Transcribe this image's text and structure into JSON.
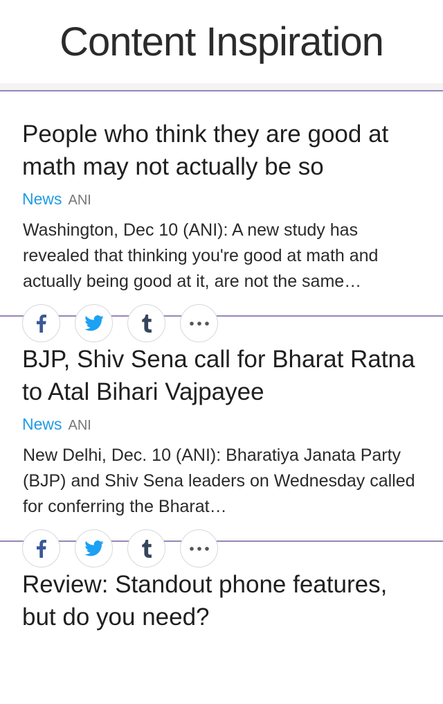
{
  "header": {
    "title": "Content Inspiration"
  },
  "colors": {
    "accent": "#1e9be6",
    "divider": "#9686b8",
    "facebook": "#3b5998",
    "twitter": "#1da1f2",
    "tumblr": "#35465c"
  },
  "articles": [
    {
      "title": "People who think they are good at math may not actually be so",
      "category": "News",
      "source": "ANI",
      "summary": "Washington, Dec 10 (ANI): A new study has revealed that thinking you're good at math and actually being good at it, are not the same…",
      "share_icons": [
        "facebook-icon",
        "twitter-icon",
        "tumblr-icon",
        "more-icon"
      ]
    },
    {
      "title": "BJP, Shiv Sena call for Bharat Ratna to Atal Bihari Vajpayee",
      "category": "News",
      "source": "ANI",
      "summary": "New Delhi, Dec. 10 (ANI): Bharatiya Janata Party (BJP) and Shiv Sena leaders on Wednesday called for conferring the Bharat…",
      "share_icons": [
        "facebook-icon",
        "twitter-icon",
        "tumblr-icon",
        "more-icon"
      ]
    },
    {
      "title": "Review: Standout phone features, but do you need?"
    }
  ]
}
